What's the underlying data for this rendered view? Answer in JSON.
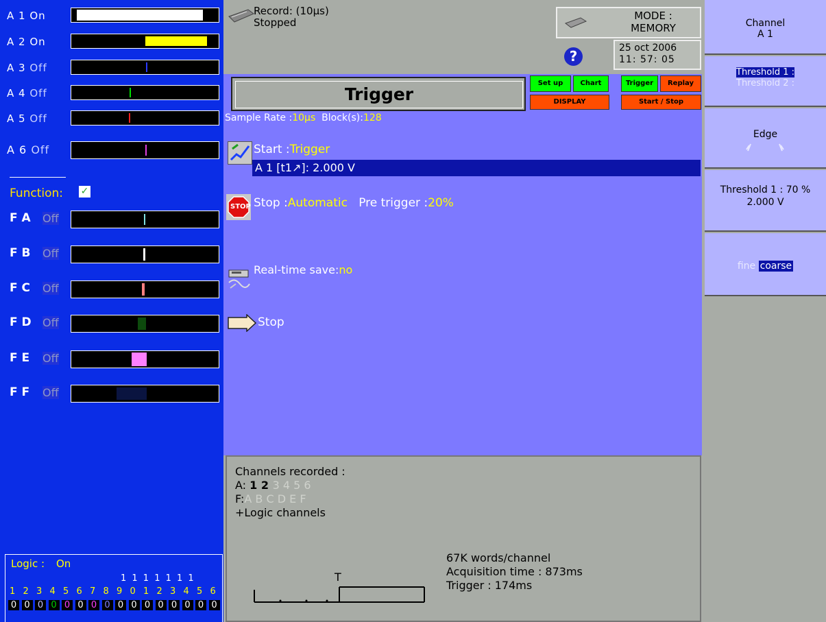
{
  "analog_channels": [
    {
      "label": "A 1",
      "state": "On"
    },
    {
      "label": "A 2",
      "state": "On"
    },
    {
      "label": "A 3",
      "state": "Off"
    },
    {
      "label": "A 4",
      "state": "Off"
    },
    {
      "label": "A 5",
      "state": "Off"
    },
    {
      "label": "A 6",
      "state": "Off"
    }
  ],
  "function": {
    "label": "Function:",
    "check": "✓"
  },
  "function_channels": [
    {
      "label": "F A",
      "state": "Off"
    },
    {
      "label": "F B",
      "state": "Off"
    },
    {
      "label": "F C",
      "state": "Off"
    },
    {
      "label": "F D",
      "state": "Off"
    },
    {
      "label": "F E",
      "state": "Off"
    },
    {
      "label": "F F",
      "state": "Off"
    }
  ],
  "logic": {
    "label": "Logic :",
    "state": "On",
    "tens_row": "1 1 1 1 1 1 1",
    "digits": [
      "1",
      "2",
      "3",
      "4",
      "5",
      "6",
      "7",
      "8",
      "9",
      "0",
      "1",
      "2",
      "3",
      "4",
      "5",
      "6"
    ],
    "values": [
      "0",
      "0",
      "0",
      "0",
      "0",
      "0",
      "0",
      "0",
      "0",
      "0",
      "0",
      "0",
      "0",
      "0",
      "0",
      "0"
    ]
  },
  "record": {
    "line1": "Record: (10µs)",
    "line2": "Stopped"
  },
  "mode": {
    "label": "MODE :",
    "value": "MEMORY"
  },
  "help_symbol": "?",
  "datetime": {
    "date": "25 oct 2006",
    "time": "11: 57: 05"
  },
  "page_title": "Trigger",
  "nav_buttons": {
    "setup": "Set up",
    "chart": "Chart",
    "trigger": "Trigger",
    "replay": "Replay",
    "display": "DISPLAY",
    "start_stop": "Start / Stop"
  },
  "sample": {
    "label": "Sample Rate :",
    "rate": "10µs",
    "block_label": "Block(s):",
    "blocks": "128"
  },
  "start": {
    "label": "Start :",
    "value": "Trigger",
    "condition": "A 1 [t1↗]:  2.000 V"
  },
  "stop": {
    "icon_text": "STOP",
    "label": "Stop  :",
    "value": "Automatic",
    "pretrigger_label": "Pre trigger :",
    "pretrigger": "20%"
  },
  "realtime": {
    "label": "Real-time save:",
    "value": "no"
  },
  "status_stop": "Stop",
  "recorded": {
    "title": "Channels recorded :",
    "a_prefix": "A:",
    "a_active": [
      "1",
      "2"
    ],
    "a_inactive": [
      "3",
      "4",
      "5",
      "6"
    ],
    "f_prefix": "F:",
    "f_inactive": [
      "A",
      "B",
      "C",
      "D",
      "E",
      "F"
    ],
    "logic": "+Logic channels"
  },
  "acq": {
    "t_marker": "T",
    "words": "67K words/channel",
    "acq_time": "Acquisition time : 873ms",
    "trigger": "Trigger : 174ms"
  },
  "right_panel": {
    "channel_label": "Channel",
    "channel_value": "A 1",
    "threshold1": "Threshold 1 :",
    "threshold2": "Threshold 2 :",
    "edge": "Edge",
    "thr_info_line1": "Threshold 1 :   70 %",
    "thr_info_line2": "2.000 V",
    "fine": "fine",
    "coarse": "coarse"
  },
  "colors": {
    "left_bg": "#0b2de6",
    "center_bg": "#7d79ff",
    "highlight": "#ffff00",
    "nav_green": "#00ff00",
    "nav_orange": "#ff4d00",
    "right_btn": "#b3b3ff"
  }
}
